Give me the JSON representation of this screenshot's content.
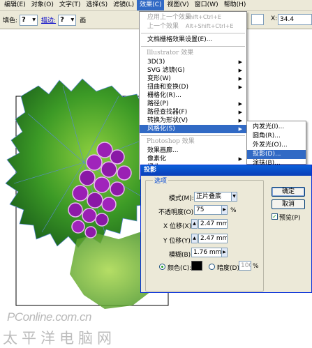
{
  "menubar": {
    "items": [
      {
        "label": "编辑(E)"
      },
      {
        "label": "对象(O)"
      },
      {
        "label": "文字(T)"
      },
      {
        "label": "选择(S)"
      },
      {
        "label": "滤镜(L)"
      },
      {
        "label": "效果(C)"
      },
      {
        "label": "视图(V)"
      },
      {
        "label": "窗口(W)"
      },
      {
        "label": "帮助(H)"
      }
    ]
  },
  "controlbar": {
    "fill_label": "填色:",
    "fill_value": "?",
    "stroke_label": "描边:",
    "stroke_value": "?",
    "brush_label": "画",
    "x_label": "X:",
    "x_value": "34.4"
  },
  "effect_menu": {
    "items": [
      {
        "label": "应用上一个效果",
        "shortcut": "Shift+Ctrl+E",
        "disabled": true
      },
      {
        "label": "上一个效果",
        "shortcut": "Alt+Shift+Ctrl+E",
        "disabled": true
      },
      {
        "label": "文档栅格效果设置(E)..."
      },
      {
        "header": "Illustrator 效果"
      },
      {
        "label": "3D(3)",
        "sub": true
      },
      {
        "label": "SVG 滤镜(G)",
        "sub": true
      },
      {
        "label": "变形(W)",
        "sub": true
      },
      {
        "label": "扭曲和变换(D)",
        "sub": true
      },
      {
        "label": "栅格化(R)..."
      },
      {
        "label": "路径(P)",
        "sub": true
      },
      {
        "label": "路径查找器(F)",
        "sub": true
      },
      {
        "label": "转换为形状(V)",
        "sub": true
      },
      {
        "label": "风格化(S)",
        "sub": true,
        "highlighted": true
      },
      {
        "header": "Photoshop 效果"
      },
      {
        "label": "效果画廊..."
      },
      {
        "label": "像素化",
        "sub": true
      },
      {
        "label": "扭曲",
        "sub": true
      }
    ]
  },
  "submenu": {
    "items": [
      {
        "label": "内发光(I)..."
      },
      {
        "label": "圆角(R)..."
      },
      {
        "label": "外发光(O)..."
      },
      {
        "label": "投影(D)...",
        "highlighted": true
      },
      {
        "label": "涂抹(B)..."
      }
    ]
  },
  "dialog": {
    "title": "投影",
    "group_title": "选项",
    "mode_label": "模式(M):",
    "mode_value": "正片叠底",
    "opacity_label": "不透明度(O):",
    "opacity_value": "75",
    "opacity_unit": "%",
    "x_offset_label": "X 位移(X):",
    "x_offset_value": "2.47 mm",
    "y_offset_label": "Y 位移(Y):",
    "y_offset_value": "2.47 mm",
    "blur_label": "模糊(B):",
    "blur_value": "1.76 mm",
    "color_label": "颜色(C):",
    "color_value": "#000000",
    "darkness_label": "暗度(D):",
    "darkness_value": "100",
    "darkness_unit": "%",
    "ok_label": "确定",
    "cancel_label": "取消",
    "preview_label": "预览(P)",
    "preview_checked": true,
    "color_selected": true
  },
  "watermark": {
    "line1": "PConline.com.cn",
    "line2": "太平洋电脑网"
  },
  "colors": {
    "leaf_dark": "#1f6a1f",
    "leaf_light": "#7ec43a",
    "grape": "#9a1fb4",
    "highlight": "#316ac5"
  }
}
